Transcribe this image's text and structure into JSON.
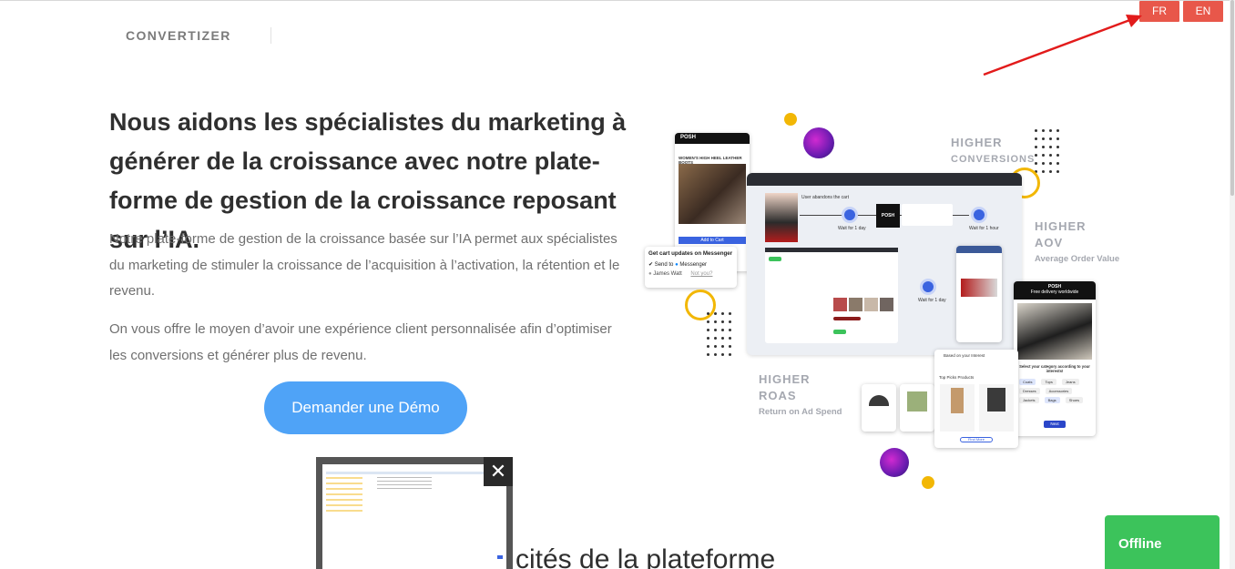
{
  "header": {
    "logo": "CONVERTIZER",
    "languages": [
      "FR",
      "EN"
    ]
  },
  "hero": {
    "title": "Nous aidons les spécialistes du marketing à générer de la croissance avec notre plate-forme de gestion de la croissance reposant sur l’IA.",
    "paragraph1": "Notre plate-forme de gestion de la croissance basée sur l’IA permet aux spécialistes du marketing de stimuler la croissance de l’acquisition à l’activation, la rétention et le revenu.",
    "paragraph2": "On vous offre le moyen d’avoir une expérience client personnalisée afin d’optimiser les conversions et générer plus de revenu.",
    "cta": "Demander une Démo"
  },
  "illustration": {
    "higher_conversions": [
      "HIGHER",
      "CONVERSIONS"
    ],
    "higher_aov": [
      "HIGHER",
      "AOV"
    ],
    "aov_sub": "Average Order Value",
    "higher_roas": [
      "HIGHER",
      "ROAS"
    ],
    "roas_sub": "Return on Ad Spend",
    "brand": "POSH",
    "messenger_title": "Get cart updates on Messenger",
    "messenger_send": "Send to",
    "messenger_name": "Messenger",
    "messenger_user": "James Watt",
    "messenger_notyou": "Not you?",
    "product_title": "WOMEN'S HIGH HEEL LEATHER BOOTS",
    "add_to_cart": "Add to Cart",
    "free_delivery": "Free delivery worldwide",
    "select_category": "Select your category according to your interests!",
    "categories": [
      "Coats",
      "Tops",
      "Jeans",
      "Dresses",
      "Accessories",
      "Jackets",
      "Bags",
      "Shoes"
    ],
    "next_label": "Next",
    "find_more": "Find More",
    "based_on_interest": "Based on your Interest",
    "top_picks": "Top Picks Products",
    "flow_wait_1": "Wait for 1 day",
    "flow_wait_2": "Wait for 1 hour",
    "flow_wait_3": "Wait for 1 day",
    "flow_user_abandon": "User abandons the cart"
  },
  "section": {
    "title_partial": "cités de la plateforme"
  },
  "preview": {
    "close": "✕"
  },
  "chat": {
    "status": "Offline"
  },
  "colors": {
    "lang_button": "#e8574a",
    "cta": "#4fa3f7",
    "offline": "#3cc35b",
    "arrow": "#e21b1b",
    "flow_node": "#3a63e0",
    "accent_yellow": "#f2b705"
  }
}
